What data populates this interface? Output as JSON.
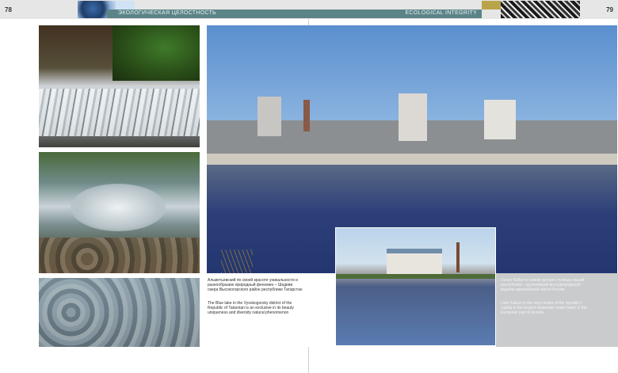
{
  "header": {
    "left_page_number": "78",
    "right_page_number": "79",
    "left_section_title": "ЭКОЛОГИЧЕСКАЯ ЦЕЛОСТНОСТЬ",
    "right_section_title": "ECOLOGICAL INTEGRITY"
  },
  "photos": {
    "waterfall": "waterfall-photo",
    "pond": "pond-reflection-photo",
    "stones": "stream-stones-photo",
    "city": "kazan-river-skyline-photo",
    "inset": "embankment-stadium-photo"
  },
  "captions": {
    "left_ru": "Альметьевский по своей красоте уникальности и разнообразию природный феномен – Шедеви озера Высокогорского район республики Татарстан",
    "left_en": "The Blue lake in the Vysokogorsky district of the Republic of Tatarstan is an exclusive in its beauty uniqueness and diversity natural phenomenon",
    "right_ru": "Озеро Кабан в самом центре столицы нашей республики – крупнейший внутригородской водоём европейской части России",
    "right_en": "Lake Kaban in the very centre of the republic's capital is the largest intraurban water basin in the European part of Russia"
  }
}
